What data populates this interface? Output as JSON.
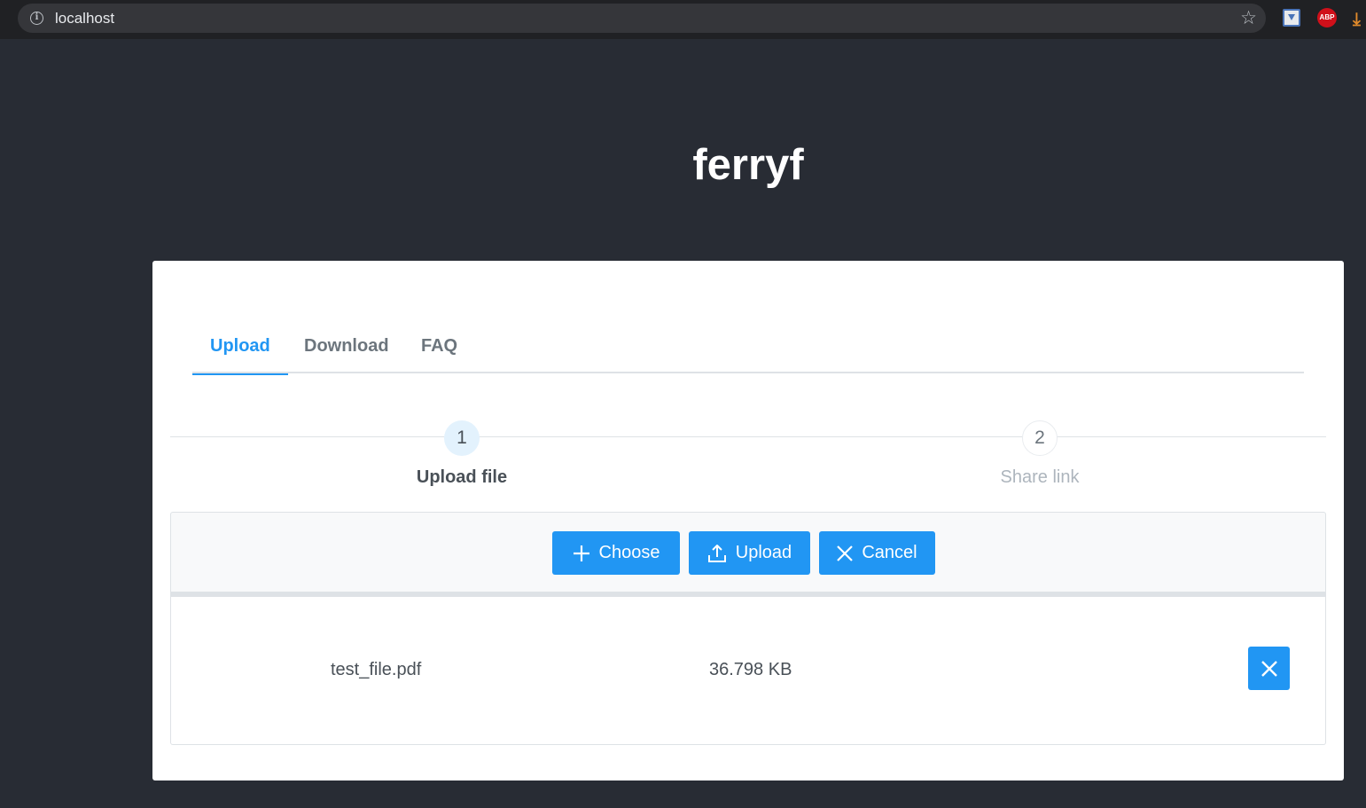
{
  "browser": {
    "url": "localhost",
    "extensions": {
      "abp_label": "ABP"
    }
  },
  "app": {
    "title": "ferryf"
  },
  "tabs": [
    {
      "label": "Upload",
      "active": true
    },
    {
      "label": "Download",
      "active": false
    },
    {
      "label": "FAQ",
      "active": false
    }
  ],
  "steps": [
    {
      "number": "1",
      "label": "Upload file",
      "active": true
    },
    {
      "number": "2",
      "label": "Share link",
      "active": false
    }
  ],
  "uploader": {
    "choose_label": "Choose",
    "upload_label": "Upload",
    "cancel_label": "Cancel",
    "files": [
      {
        "name": "test_file.pdf",
        "size": "36.798 KB"
      }
    ]
  },
  "colors": {
    "background": "#282c34",
    "accent": "#2196f3",
    "card": "#ffffff"
  }
}
